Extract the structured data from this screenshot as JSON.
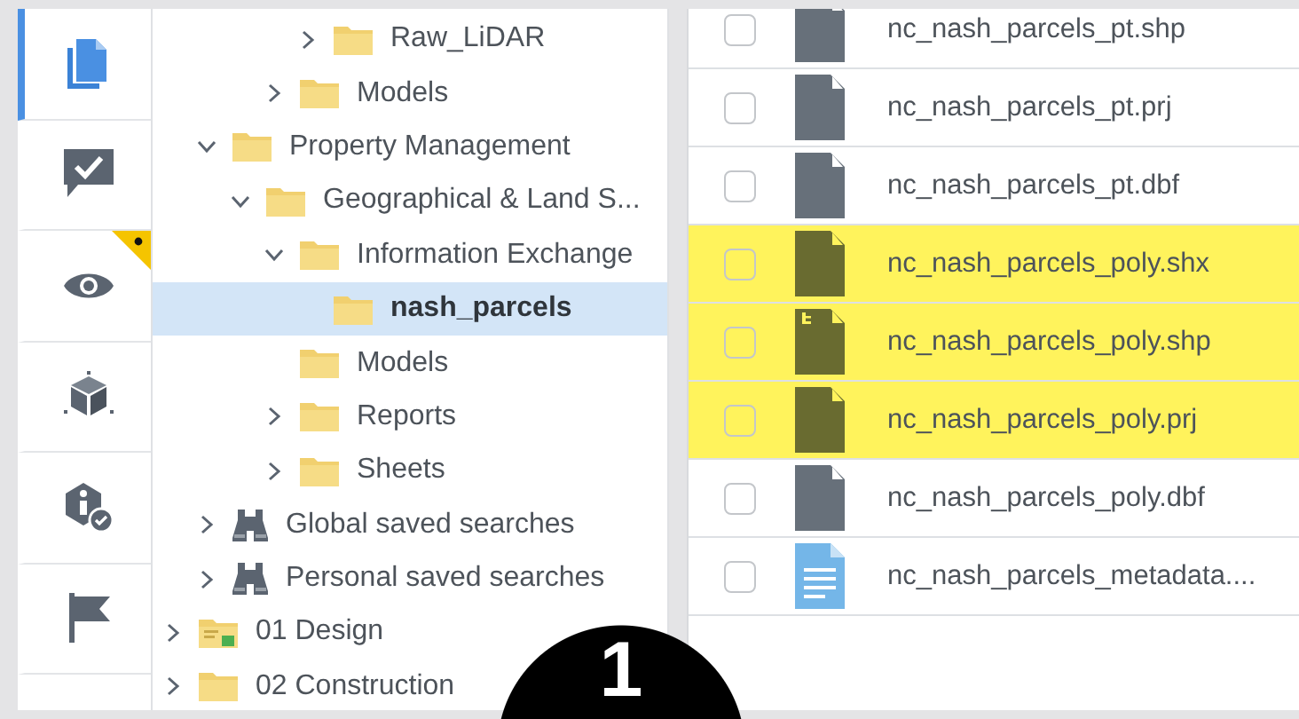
{
  "rail": {
    "items": [
      {
        "kind": "documents",
        "selected": true,
        "notification": false
      },
      {
        "kind": "review",
        "selected": false,
        "notification": false
      },
      {
        "kind": "view",
        "selected": false,
        "notification": true
      },
      {
        "kind": "model",
        "selected": false,
        "notification": false
      },
      {
        "kind": "info",
        "selected": false,
        "notification": false
      },
      {
        "kind": "flag",
        "selected": false,
        "notification": false
      }
    ]
  },
  "tree": {
    "items": [
      {
        "children": [
          {
            "children": [
              {
                "children": [
                  {
                    "children": [
                      {
                        "label": "Raw_LiDAR",
                        "kind": "folder",
                        "expanded": false,
                        "selected": false
                      }
                    ]
                  },
                  {
                    "label": "Models",
                    "kind": "folder",
                    "expanded": false,
                    "selected": false
                  }
                ]
              }
            ]
          },
          {
            "label": "Property Management",
            "kind": "folder",
            "expanded": true,
            "selected": false,
            "children": [
              {
                "label": "Geographical & Land S...",
                "kind": "folder",
                "expanded": true,
                "selected": false,
                "children": [
                  {
                    "label": "Information Exchange",
                    "kind": "folder",
                    "expanded": true,
                    "selected": false,
                    "children": [
                      {
                        "label": "nash_parcels",
                        "kind": "folder",
                        "selected": true
                      }
                    ]
                  },
                  {
                    "label": "Models",
                    "kind": "folder",
                    "selected": false
                  },
                  {
                    "label": "Reports",
                    "kind": "folder",
                    "expanded": false,
                    "selected": false
                  },
                  {
                    "label": "Sheets",
                    "kind": "folder",
                    "expanded": false,
                    "selected": false
                  }
                ]
              }
            ]
          },
          {
            "label": "Global saved searches",
            "kind": "search",
            "expanded": false,
            "selected": false
          },
          {
            "label": "Personal saved searches",
            "kind": "search",
            "expanded": false,
            "selected": false
          }
        ]
      },
      {
        "label": "01 Design",
        "kind": "project",
        "expanded": false,
        "selected": false
      },
      {
        "label": "02 Construction",
        "kind": "folder",
        "expanded": false,
        "selected": false
      }
    ]
  },
  "files": {
    "rows": [
      {
        "name": "nc_nash_parcels_pt.shp",
        "kind": "file",
        "checked": false,
        "highlighted": false
      },
      {
        "name": "nc_nash_parcels_pt.prj",
        "kind": "file",
        "checked": false,
        "highlighted": false
      },
      {
        "name": "nc_nash_parcels_pt.dbf",
        "kind": "file",
        "checked": false,
        "highlighted": false
      },
      {
        "name": "nc_nash_parcels_poly.shx",
        "kind": "file",
        "checked": false,
        "highlighted": true
      },
      {
        "name": "nc_nash_parcels_poly.shp",
        "kind": "shape",
        "checked": false,
        "highlighted": true
      },
      {
        "name": "nc_nash_parcels_poly.prj",
        "kind": "file",
        "checked": false,
        "highlighted": true
      },
      {
        "name": "nc_nash_parcels_poly.dbf",
        "kind": "file",
        "checked": false,
        "highlighted": false
      },
      {
        "name": "nc_nash_parcels_metadata....",
        "kind": "document",
        "checked": false,
        "highlighted": false
      }
    ]
  },
  "step_marker": {
    "number": "1"
  }
}
